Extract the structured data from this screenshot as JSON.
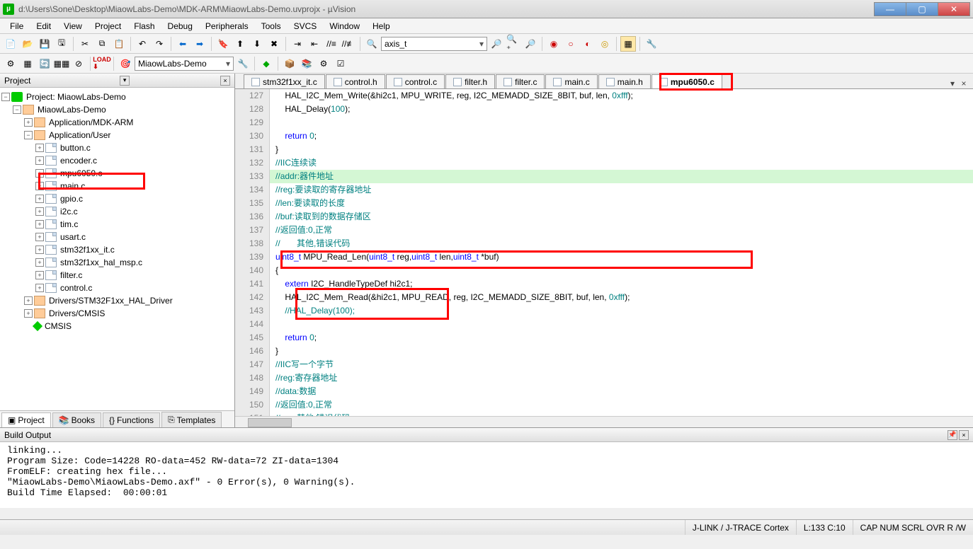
{
  "title_bar": {
    "path": "d:\\Users\\Sone\\Desktop\\MiaowLabs-Demo\\MDK-ARM\\MiaowLabs-Demo.uvprojx - µVision"
  },
  "menus": [
    "File",
    "Edit",
    "View",
    "Project",
    "Flash",
    "Debug",
    "Peripherals",
    "Tools",
    "SVCS",
    "Window",
    "Help"
  ],
  "search_box": "axis_t",
  "target_sel": "MiaowLabs-Demo",
  "project": {
    "panel_title": "Project",
    "root": "Project: MiaowLabs-Demo",
    "target": "MiaowLabs-Demo",
    "groups": [
      {
        "name": "Application/MDK-ARM",
        "files": []
      },
      {
        "name": "Application/User",
        "files": [
          "button.c",
          "encoder.c",
          "mpu6050.c",
          "main.c",
          "gpio.c",
          "i2c.c",
          "tim.c",
          "usart.c",
          "stm32f1xx_it.c",
          "stm32f1xx_hal_msp.c",
          "filter.c",
          "control.c"
        ]
      },
      {
        "name": "Drivers/STM32F1xx_HAL_Driver",
        "files": []
      },
      {
        "name": "Drivers/CMSIS",
        "files": []
      }
    ],
    "cmsis_node": "CMSIS",
    "tabs": [
      "Project",
      "Books",
      "Functions",
      "Templates"
    ]
  },
  "editor": {
    "tabs": [
      "stm32f1xx_it.c",
      "control.h",
      "control.c",
      "filter.h",
      "filter.c",
      "main.c",
      "main.h",
      "mpu6050.c"
    ],
    "active_tab": 7,
    "first_line": 127,
    "lines": [
      "    HAL_I2C_Mem_Write(&hi2c1, MPU_WRITE, reg, I2C_MEMADD_SIZE_8BIT, buf, len, 0xfff);",
      "    HAL_Delay(100);",
      "",
      "    return 0;",
      "}",
      "//IIC连续读",
      "//addr:器件地址",
      "//reg:要读取的寄存器地址",
      "//len:要读取的长度",
      "//buf:读取到的数据存储区",
      "//返回值:0,正常",
      "//       其他,错误代码",
      "uint8_t MPU_Read_Len(uint8_t reg,uint8_t len,uint8_t *buf)",
      "{",
      "    extern I2C_HandleTypeDef hi2c1;",
      "    HAL_I2C_Mem_Read(&hi2c1, MPU_READ, reg, I2C_MEMADD_SIZE_8BIT, buf, len, 0xfff);",
      "    //HAL_Delay(100);",
      "",
      "    return 0;",
      "}",
      "//IIC写一个字节",
      "//reg:寄存器地址",
      "//data:数据",
      "//返回值:0,正常",
      "//       其他,错误代码"
    ],
    "highlight_index": 6
  },
  "build": {
    "title": "Build Output",
    "lines": [
      "linking...",
      "Program Size: Code=14228 RO-data=452 RW-data=72 ZI-data=1304",
      "FromELF: creating hex file...",
      "\"MiaowLabs-Demo\\MiaowLabs-Demo.axf\" - 0 Error(s), 0 Warning(s).",
      "Build Time Elapsed:  00:00:01"
    ]
  },
  "status": {
    "debugger": "J-LINK / J-TRACE Cortex",
    "cursor": "L:133 C:10",
    "flags": "CAP  NUM  SCRL  OVR  R /W"
  }
}
